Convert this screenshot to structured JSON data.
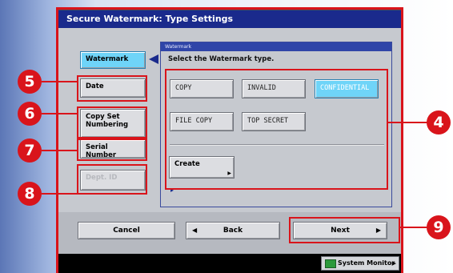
{
  "window": {
    "title": "Secure Watermark: Type Settings"
  },
  "tabs": [
    {
      "label": "Watermark",
      "state": "active"
    },
    {
      "label": "Date",
      "state": "normal"
    },
    {
      "label": "Copy Set\nNumbering",
      "state": "normal"
    },
    {
      "label": "Serial Number",
      "state": "normal"
    },
    {
      "label": "Dept. ID",
      "state": "disabled"
    }
  ],
  "panel": {
    "header": "Watermark",
    "instruction": "Select the Watermark type.",
    "types": [
      "COPY",
      "INVALID",
      "CONFIDENTIAL",
      "FILE COPY",
      "TOP SECRET"
    ],
    "selected": "CONFIDENTIAL",
    "create_label": "Create"
  },
  "footer": {
    "cancel": "Cancel",
    "back": "Back",
    "next": "Next"
  },
  "status": {
    "system_monitor": "System Monitor"
  },
  "callouts": [
    "4",
    "5",
    "6",
    "7",
    "8",
    "9"
  ],
  "colors": {
    "accent": "#6fd4f8",
    "title_bar": "#1a2a8c",
    "callout": "#d9141b"
  }
}
